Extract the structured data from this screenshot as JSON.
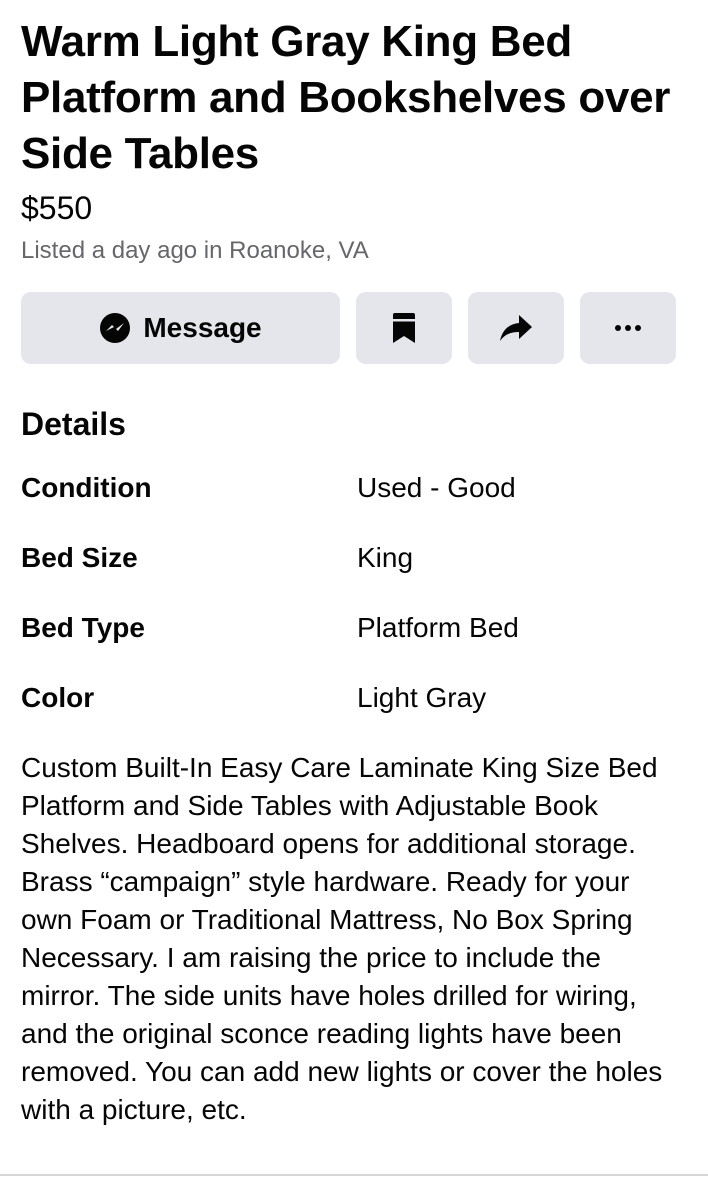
{
  "listing": {
    "title": "Warm Light Gray King Bed Platform and Bookshelves over Side Tables",
    "price": "$550",
    "meta": "Listed a day ago in Roanoke, VA"
  },
  "actions": {
    "message_label": "Message",
    "save_icon": "bookmark-icon",
    "share_icon": "share-arrow-icon",
    "more_icon": "more-dots-icon"
  },
  "details": {
    "heading": "Details",
    "rows": [
      {
        "key": "Condition",
        "value": "Used - Good"
      },
      {
        "key": "Bed Size",
        "value": "King"
      },
      {
        "key": "Bed Type",
        "value": "Platform Bed"
      },
      {
        "key": "Color",
        "value": "Light Gray"
      }
    ]
  },
  "description": "Custom Built-In Easy Care Laminate King Size Bed Platform and Side Tables with Adjustable Book Shelves. Headboard opens for additional storage. Brass “campaign” style hardware. Ready for your own Foam or Traditional Mattress, No Box Spring Necessary. I am raising the price to include the mirror. The side units have holes drilled for wiring, and the original sconce reading lights have been removed. You can add new lights or cover the holes with a picture, etc.",
  "colors": {
    "button_bg": "#e4e6eb",
    "text": "#050505",
    "secondary_text": "#65676b"
  }
}
